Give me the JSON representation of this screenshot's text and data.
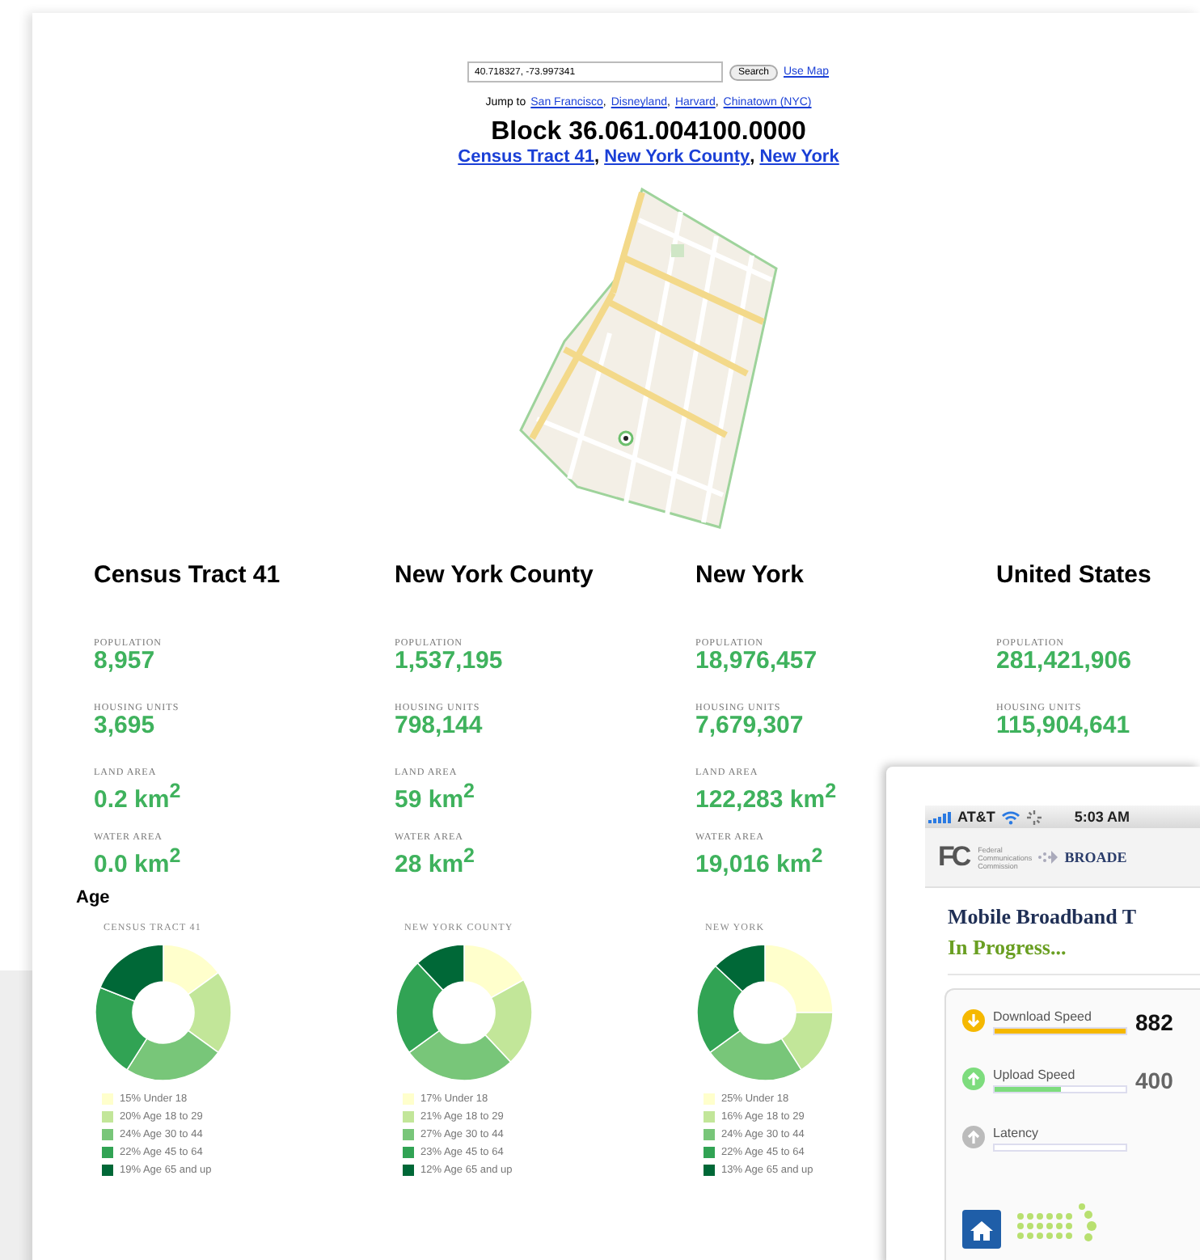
{
  "search": {
    "value": "40.718327, -73.997341",
    "button": "Search",
    "map_link": "Use Map"
  },
  "jump": {
    "label": "Jump to",
    "separator": ",",
    "links": [
      "San Francisco",
      "Disneyland",
      "Harvard",
      "Chinatown (NYC)"
    ]
  },
  "block": {
    "title": "Block 36.061.004100.0000",
    "separator": ",",
    "links": [
      "Census Tract 41",
      "New York County",
      "New York"
    ]
  },
  "regions": [
    {
      "name": "Census Tract 41",
      "stats": [
        {
          "label": "POPULATION",
          "value": "8,957"
        },
        {
          "label": "HOUSING UNITS",
          "value": "3,695"
        },
        {
          "label": "LAND AREA",
          "value": "0.2 km$^{2}$"
        },
        {
          "label": "WATER AREA",
          "value": "0.0 km$^{2}$"
        }
      ]
    },
    {
      "name": "New York County",
      "stats": [
        {
          "label": "POPULATION",
          "value": "1,537,195"
        },
        {
          "label": "HOUSING UNITS",
          "value": "798,144"
        },
        {
          "label": "LAND AREA",
          "value": "59 km$^{2}$"
        },
        {
          "label": "WATER AREA",
          "value": "28 km$^{2}$"
        }
      ]
    },
    {
      "name": "New York",
      "stats": [
        {
          "label": "POPULATION",
          "value": "18,976,457"
        },
        {
          "label": "HOUSING UNITS",
          "value": "7,679,307"
        },
        {
          "label": "LAND AREA",
          "value": "122,283 km$^{2}$"
        },
        {
          "label": "WATER AREA",
          "value": "19,016 km$^{2}$"
        }
      ]
    },
    {
      "name": "United States",
      "stats": [
        {
          "label": "POPULATION",
          "value": "281,421,906"
        },
        {
          "label": "HOUSING UNITS",
          "value": "115,904,641"
        }
      ]
    }
  ],
  "age": {
    "title": "Age",
    "charts": [
      {
        "chart_data": {
          "type": "donut",
          "title": "CENSUS TRACT 41",
          "categories": [
            "15% Under 18",
            "20% Age 18 to 29",
            "24% Age 30 to 44",
            "22% Age 45 to 64",
            "19% Age 65 and up"
          ],
          "values": [
            15,
            20,
            24,
            22,
            19
          ],
          "colors": [
            "#ffffcc",
            "#c2e699",
            "#78c679",
            "#31a354",
            "#006837"
          ],
          "legend": "bottom"
        }
      },
      {
        "chart_data": {
          "type": "donut",
          "title": "NEW YORK COUNTY",
          "categories": [
            "17% Under 18",
            "21% Age 18 to 29",
            "27% Age 30 to 44",
            "23% Age 45 to 64",
            "12% Age 65 and up"
          ],
          "values": [
            17,
            21,
            27,
            23,
            12
          ],
          "colors": [
            "#ffffcc",
            "#c2e699",
            "#78c679",
            "#31a354",
            "#006837"
          ],
          "legend": "bottom"
        }
      },
      {
        "chart_data": {
          "type": "donut",
          "title": "NEW YORK",
          "categories": [
            "25% Under 18",
            "16% Age 18 to 29",
            "24% Age 30 to 44",
            "22% Age 45 to 64",
            "13% Age 65 and up"
          ],
          "values": [
            25,
            16,
            24,
            22,
            13
          ],
          "colors": [
            "#ffffcc",
            "#c2e699",
            "#78c679",
            "#31a354",
            "#006837"
          ],
          "legend": "bottom"
        }
      }
    ]
  },
  "phone": {
    "carrier": "AT&T",
    "time": "5:03 AM",
    "logo": "FC",
    "agency": [
      "Federal",
      "Communications",
      "Commission"
    ],
    "brand": "BROADE",
    "title": "Mobile Broadband T",
    "status": "In Progress...",
    "metrics": [
      {
        "label": "Download Speed",
        "level": 1.0,
        "value": "882",
        "color": "#f5b800"
      },
      {
        "label": "Upload Speed",
        "level": 0.5,
        "value": "400",
        "color": "#7ddc7d"
      },
      {
        "label": "Latency",
        "color": "#bbbbbb"
      }
    ]
  }
}
